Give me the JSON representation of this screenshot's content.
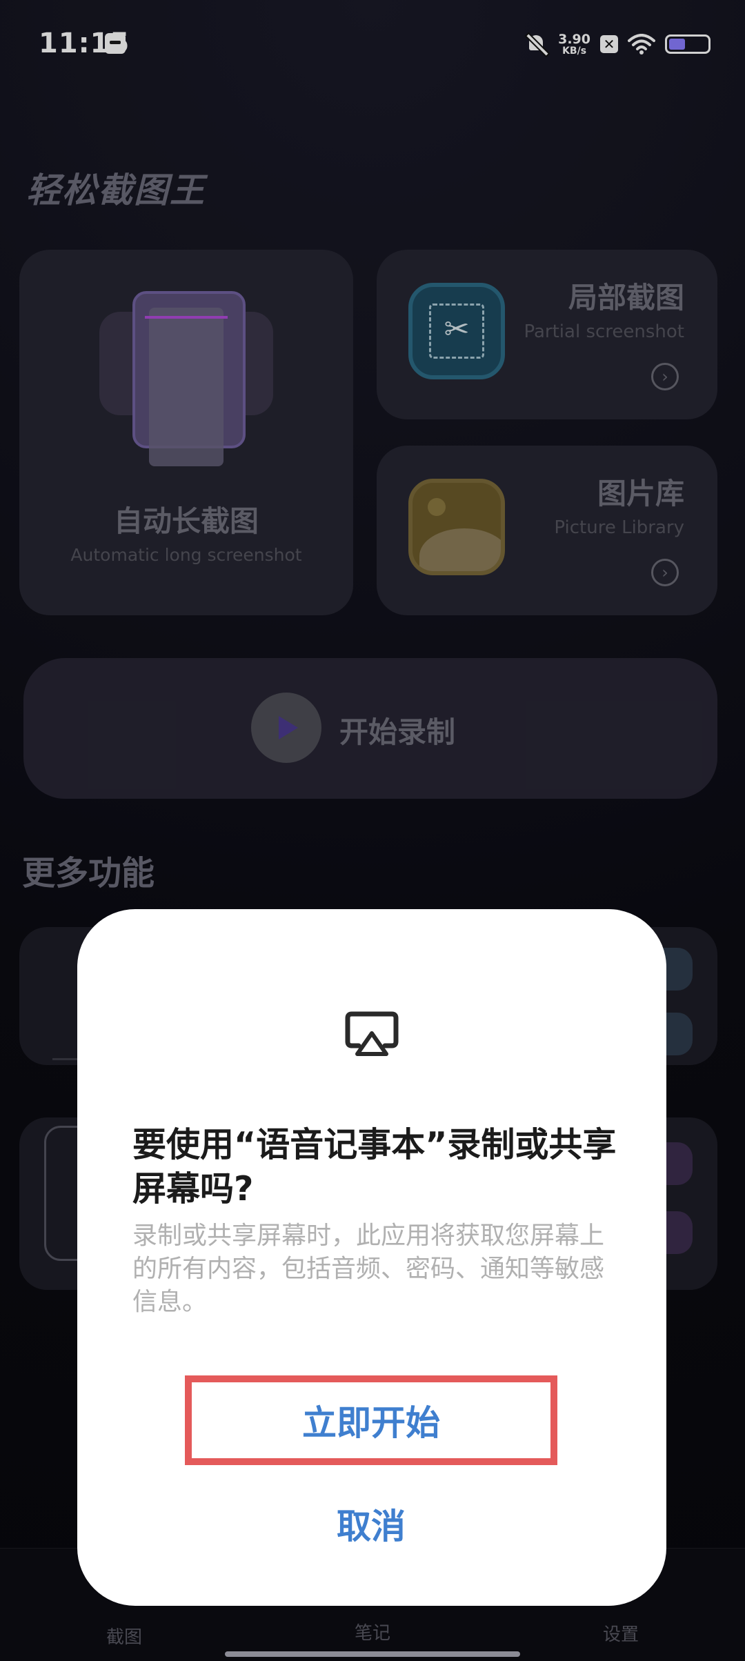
{
  "status_bar": {
    "time": "11:15",
    "net_speed_value": "3.90",
    "net_speed_unit": "KB/s",
    "battery_level_percent": 42,
    "battery_color": "#8a7dff"
  },
  "app": {
    "title": "轻松截图王",
    "cards": {
      "auto_long": {
        "title": "自动长截图",
        "subtitle": "Automatic long screenshot"
      },
      "partial": {
        "title": "局部截图",
        "subtitle": "Partial screenshot"
      },
      "gallery": {
        "title": "图片库",
        "subtitle": "Picture Library"
      }
    },
    "record": {
      "label": "开始录制"
    },
    "more_title": "更多功能"
  },
  "bottom_nav": {
    "items": [
      {
        "label": "截图"
      },
      {
        "label": "笔记"
      },
      {
        "label": "设置"
      }
    ]
  },
  "dialog": {
    "icon": "screen-cast-icon",
    "title": "要使用“语音记事本”录制或共享屏幕吗?",
    "description": "录制或共享屏幕时，此应用将获取您屏幕上的所有内容，包括音频、密码、通知等敏感信息。",
    "start_label": "立即开始",
    "cancel_label": "取消",
    "accent_color": "#3f7fcf",
    "highlight_color": "#e45a5a"
  }
}
